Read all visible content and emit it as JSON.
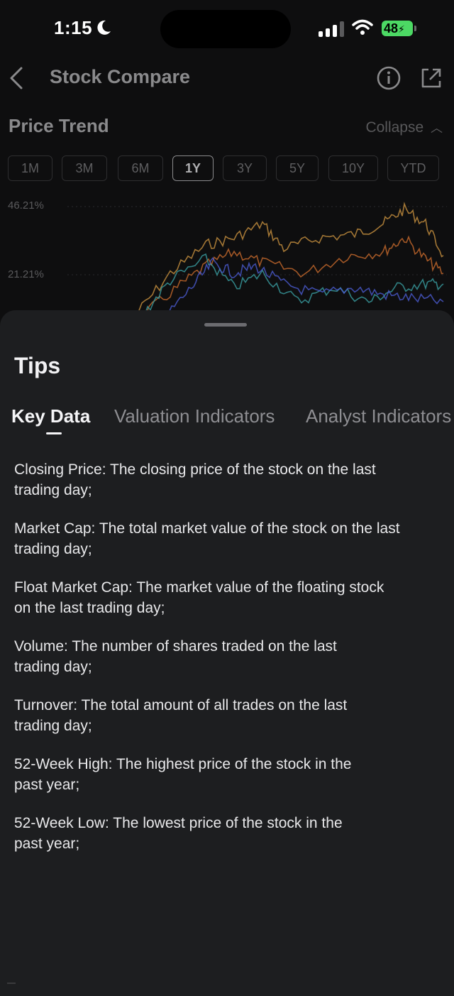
{
  "status_bar": {
    "time": "1:15",
    "battery": "48"
  },
  "header": {
    "title": "Stock Compare"
  },
  "price_trend": {
    "title": "Price Trend",
    "collapse_label": "Collapse",
    "ranges": [
      "1M",
      "3M",
      "6M",
      "1Y",
      "3Y",
      "5Y",
      "10Y",
      "YTD"
    ],
    "active_range": "1Y",
    "y_labels": [
      "46.21%",
      "21.21%"
    ],
    "series_colors": [
      "#c8913e",
      "#c86a2c",
      "#3a9ea0",
      "#4b5bd0"
    ]
  },
  "sheet": {
    "title": "Tips",
    "tabs": [
      {
        "label": "Key Data"
      },
      {
        "label": "Valuation Indicators"
      },
      {
        "label": "Analyst Indicators"
      }
    ],
    "tips": [
      "Closing Price: The closing price of the stock on the last\ntrading day;",
      "Market Cap: The total market value of the stock on the last\ntrading day;",
      "Float Market Cap: The market value of the floating stock\non the last trading day;",
      "Volume: The number of shares traded on the last\ntrading day;",
      "Turnover: The total amount of all trades on the last\ntrading day;",
      "52-Week High: The highest price of the stock in the\npast year;",
      "52-Week Low: The lowest price of the stock in the\npast year;"
    ]
  }
}
